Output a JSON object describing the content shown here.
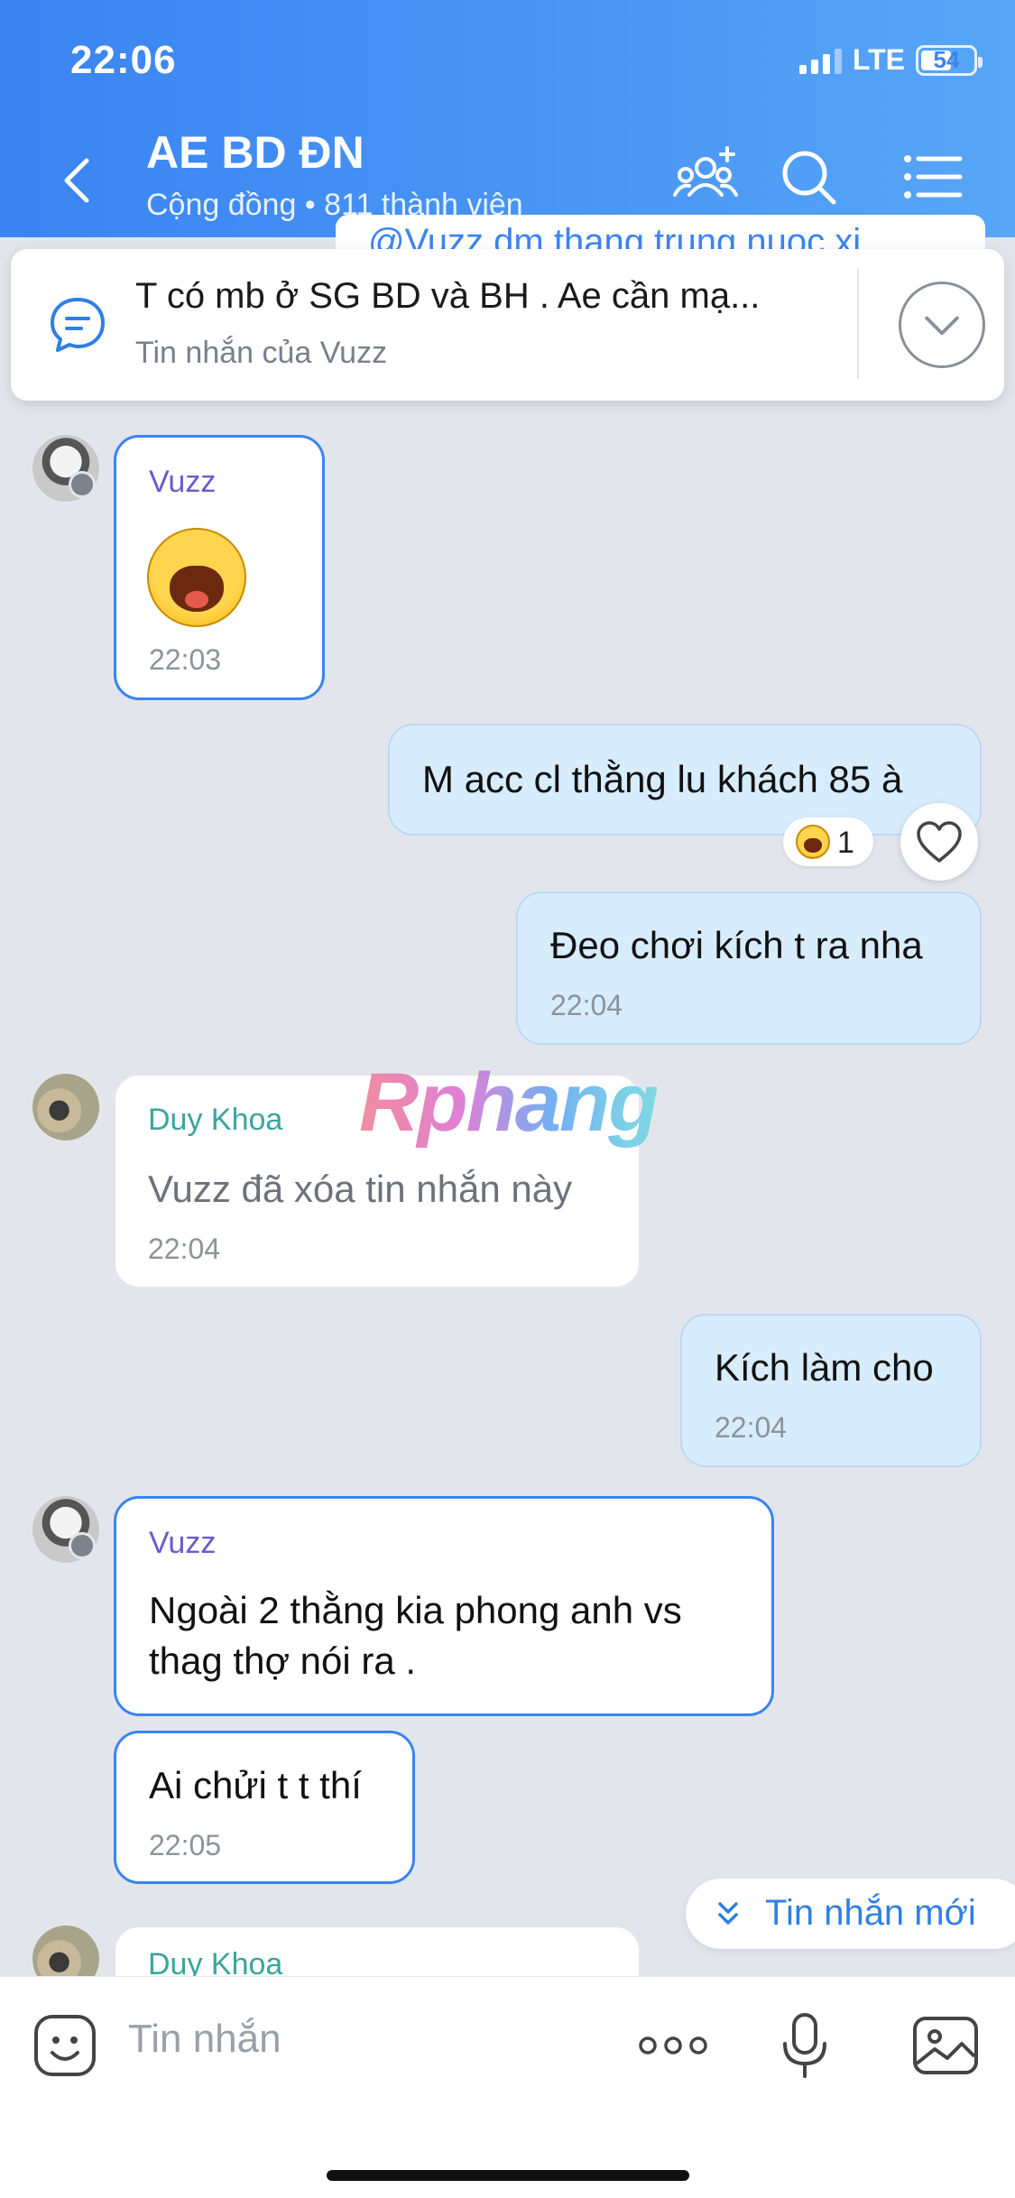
{
  "status_bar": {
    "time": "22:06",
    "network": "LTE",
    "battery": "54"
  },
  "header": {
    "title": "AE BD ĐN",
    "subtitle": "Cộng đồng • 811 thành viên",
    "icons": [
      "back-arrow-icon",
      "add-members-icon",
      "search-icon",
      "menu-list-icon"
    ]
  },
  "pinned": {
    "text": "T có mb ở SG BD và BH . Ae cần mạ...",
    "sub": "Tin nhắn của Vuzz",
    "icon": "chat-bubble-icon",
    "behind_text": "@Vuzz  dm thang trung nuoc xi"
  },
  "messages": [
    {
      "sender": "Vuzz",
      "type": "sticker",
      "sticker": "laughing-emoji",
      "time": "22:03"
    },
    {
      "sender": "me",
      "text": "M acc cl thằng lu khách 85 à",
      "reaction_count": "1"
    },
    {
      "sender": "me",
      "text": "Đeo chơi kích t ra nha",
      "time": "22:04"
    },
    {
      "sender": "Duy Khoa",
      "text": "Vuzz đã xóa tin nhắn này",
      "time": "22:04"
    },
    {
      "sender": "me",
      "text": "Kích làm cho",
      "time": "22:04"
    },
    {
      "sender": "Vuzz",
      "lines": [
        "Ngoài 2 thằng kia phong anh vs",
        "thag thợ nói ra ."
      ]
    },
    {
      "sender": "Vuzz",
      "text": "Ai chửi t t thí",
      "time": "22:05"
    },
    {
      "sender": "Duy Khoa",
      "partial": true
    }
  ],
  "watermark": "Rphang",
  "new_messages_button": "Tin nhắn mới",
  "input": {
    "placeholder": "Tin nhắn"
  },
  "colors": {
    "header": "#3a84f2",
    "accent": "#2f7fe6",
    "outgoing": "#d7ecfc",
    "background": "#e2e6ec"
  }
}
